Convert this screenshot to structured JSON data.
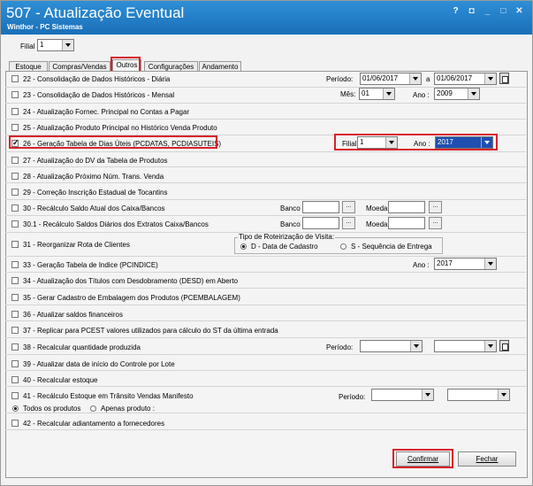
{
  "window": {
    "title": "507 - Atualização Eventual",
    "subtitle": "Winthor - PC Sistemas",
    "help_btn": "?",
    "restore_btn": "◘",
    "min_btn": "_",
    "max_btn": "□",
    "close_btn": "✕"
  },
  "filial_top": {
    "label": "Filial",
    "value": "1"
  },
  "tabs": [
    "Estoque",
    "Compras/Vendas",
    "Outros",
    "Configurações",
    "Andamento"
  ],
  "rows": {
    "r22": {
      "label": "22 - Consolidação de Dados Históricos - Diária",
      "periodo_label": "Período:",
      "date_from": "01/06/2017",
      "a_label": "a",
      "date_to": "01/06/2017"
    },
    "r23": {
      "label": "23 - Consolidação de Dados Históricos - Mensal",
      "mes_label": "Mês:",
      "mes_value": "01",
      "ano_label": "Ano :",
      "ano_value": "2009"
    },
    "r24": {
      "label": "24 - Atualização Fornec. Principal no Contas a Pagar"
    },
    "r25": {
      "label": "25 - Atualização Produto Principal no Histórico Venda Produto"
    },
    "r26": {
      "label": "26 - Geração Tabela de Dias Úteis (PCDATAS, PCDIASUTEIS)",
      "filial_label": "Filial",
      "filial_value": "1",
      "ano_label": "Ano :",
      "ano_value": "2017"
    },
    "r27": {
      "label": "27 - Atualização do DV da Tabela de Produtos"
    },
    "r28": {
      "label": "28 - Atualização Próximo Núm. Trans. Venda"
    },
    "r29": {
      "label": "29 - Correção Inscrição Estadual de Tocantins"
    },
    "r30": {
      "label": "30 - Recálculo Saldo Atual dos Caixa/Bancos",
      "banco_label": "Banco",
      "moeda_label": "Moeda",
      "dots": "..."
    },
    "r301": {
      "label": "30.1 - Recálculo Saldos Diários dos Extratos Caixa/Bancos",
      "banco_label": "Banco",
      "moeda_label": "Moeda",
      "dots": "..."
    },
    "r31": {
      "label": "31 - Reorganizar Rota de Clientes",
      "group_title": "Tipo de Roteirização de Visita:",
      "opt1": "D - Data de Cadastro",
      "opt2": "S - Sequência de Entrega"
    },
    "r33": {
      "label": "33 - Geração Tabela de Indice (PCINDICE)",
      "ano_label": "Ano :",
      "ano_value": "2017"
    },
    "r34": {
      "label": "34 - Atualização dos Títulos com Desdobramento (DESD) em Aberto"
    },
    "r35": {
      "label": "35 - Gerar Cadastro de Embalagem dos Produtos (PCEMBALAGEM)"
    },
    "r36": {
      "label": "36 - Atualizar saldos financeiros"
    },
    "r37": {
      "label": "37 - Replicar para PCEST valores utilizados para cálculo do ST da última entrada"
    },
    "r38": {
      "label": "38 - Recalcular quantidade produzida",
      "periodo_label": "Período:"
    },
    "r39": {
      "label": "39 - Atualizar data de início do Controle por Lote"
    },
    "r40": {
      "label": "40 - Recalcular estoque"
    },
    "r41": {
      "label": "41 - Recálculo Estoque em Trânsito Vendas Manifesto",
      "periodo_label": "Período:",
      "opt1": "Todos os produtos",
      "opt2": "Apenas produto :"
    },
    "r42": {
      "label": "42 - Recalcular adiantamento a fornecedores"
    }
  },
  "buttons": {
    "confirmar": "Confirmar",
    "fechar": "Fechar"
  },
  "colors": {
    "title_bar": "#1f78c4",
    "highlight_red": "#d9202a",
    "selected_blue": "#1f4fb0"
  }
}
